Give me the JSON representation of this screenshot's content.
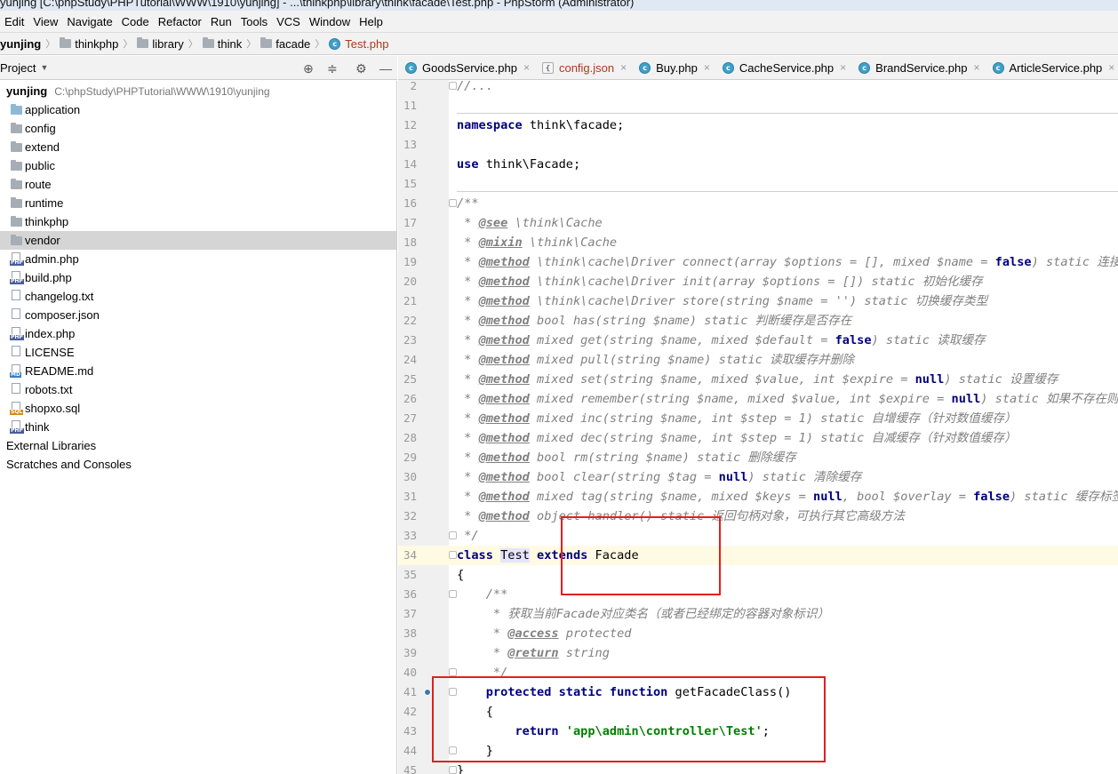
{
  "window": {
    "title": "yunjing [C:\\phpStudy\\PHPTutorial\\WWW\\1910\\yunjing] - ...\\thinkphp\\library\\think\\facade\\Test.php - PhpStorm (Administrator)"
  },
  "menu": [
    "Edit",
    "View",
    "Navigate",
    "Code",
    "Refactor",
    "Run",
    "Tools",
    "VCS",
    "Window",
    "Help"
  ],
  "breadcrumb": [
    {
      "label": "yunjing",
      "icon": "none"
    },
    {
      "label": "thinkphp",
      "icon": "folder-icon"
    },
    {
      "label": "library",
      "icon": "folder-icon"
    },
    {
      "label": "think",
      "icon": "folder-icon"
    },
    {
      "label": "facade",
      "icon": "folder-icon"
    },
    {
      "label": "Test.php",
      "icon": "php-class-icon"
    }
  ],
  "project_panel": {
    "title": "Project",
    "root": {
      "name": "yunjing",
      "path": "C:\\phpStudy\\PHPTutorial\\WWW\\1910\\yunjing"
    },
    "items": [
      {
        "name": "application",
        "icon": "folder-blue",
        "selected": false
      },
      {
        "name": "config",
        "icon": "folder",
        "selected": false
      },
      {
        "name": "extend",
        "icon": "folder",
        "selected": false
      },
      {
        "name": "public",
        "icon": "folder",
        "selected": false
      },
      {
        "name": "route",
        "icon": "folder",
        "selected": false
      },
      {
        "name": "runtime",
        "icon": "folder",
        "selected": false
      },
      {
        "name": "thinkphp",
        "icon": "folder",
        "selected": false
      },
      {
        "name": "vendor",
        "icon": "folder",
        "selected": true
      },
      {
        "name": "admin.php",
        "icon": "php",
        "selected": false
      },
      {
        "name": "build.php",
        "icon": "php",
        "selected": false
      },
      {
        "name": "changelog.txt",
        "icon": "text",
        "selected": false
      },
      {
        "name": "composer.json",
        "icon": "json",
        "selected": false
      },
      {
        "name": "index.php",
        "icon": "php",
        "selected": false
      },
      {
        "name": "LICENSE",
        "icon": "text",
        "selected": false
      },
      {
        "name": "README.md",
        "icon": "md",
        "selected": false
      },
      {
        "name": "robots.txt",
        "icon": "text",
        "selected": false
      },
      {
        "name": "shopxo.sql",
        "icon": "sql",
        "selected": false
      },
      {
        "name": "think",
        "icon": "php",
        "selected": false
      }
    ],
    "external": "External Libraries",
    "scratches": "Scratches and Consoles"
  },
  "tabs": [
    {
      "label": "GoodsService.php",
      "modified": false
    },
    {
      "label": "config.json",
      "modified": true
    },
    {
      "label": "Buy.php",
      "modified": false
    },
    {
      "label": "CacheService.php",
      "modified": false
    },
    {
      "label": "BrandService.php",
      "modified": false
    },
    {
      "label": "ArticleService.php",
      "modified": false
    }
  ],
  "editor": {
    "lines": [
      {
        "n": "2",
        "segs": [
          [
            "cm",
            "//..."
          ]
        ]
      },
      {
        "n": "11",
        "segs": []
      },
      {
        "n": "12",
        "segs": [
          [
            "kw",
            "namespace"
          ],
          [
            "",
            " think\\facade;"
          ]
        ]
      },
      {
        "n": "13",
        "segs": []
      },
      {
        "n": "14",
        "segs": [
          [
            "kw",
            "use"
          ],
          [
            "",
            " think\\Facade;"
          ]
        ]
      },
      {
        "n": "15",
        "segs": []
      },
      {
        "n": "16",
        "segs": [
          [
            "cm",
            "/**"
          ]
        ]
      },
      {
        "n": "17",
        "segs": [
          [
            "cm",
            " * "
          ],
          [
            "tg",
            "@see"
          ],
          [
            "cm",
            " \\think\\Cache"
          ]
        ]
      },
      {
        "n": "18",
        "segs": [
          [
            "cm",
            " * "
          ],
          [
            "tg",
            "@mixin"
          ],
          [
            "cm",
            " \\think\\Cache"
          ]
        ]
      },
      {
        "n": "19",
        "segs": [
          [
            "cm",
            " * "
          ],
          [
            "tg",
            "@method"
          ],
          [
            "cm",
            " \\think\\cache\\Driver connect(array $options = [], mixed $name = "
          ],
          [
            "kw",
            "false"
          ],
          [
            "cm",
            ") static 连接缓存"
          ]
        ]
      },
      {
        "n": "20",
        "segs": [
          [
            "cm",
            " * "
          ],
          [
            "tg",
            "@method"
          ],
          [
            "cm",
            " \\think\\cache\\Driver init(array $options = []) static 初始化缓存"
          ]
        ]
      },
      {
        "n": "21",
        "segs": [
          [
            "cm",
            " * "
          ],
          [
            "tg",
            "@method"
          ],
          [
            "cm",
            " \\think\\cache\\Driver store(string $name = '') static 切换缓存类型"
          ]
        ]
      },
      {
        "n": "22",
        "segs": [
          [
            "cm",
            " * "
          ],
          [
            "tg",
            "@method"
          ],
          [
            "cm",
            " bool has(string $name) static 判断缓存是否存在"
          ]
        ]
      },
      {
        "n": "23",
        "segs": [
          [
            "cm",
            " * "
          ],
          [
            "tg",
            "@method"
          ],
          [
            "cm",
            " mixed get(string $name, mixed $default = "
          ],
          [
            "kw",
            "false"
          ],
          [
            "cm",
            ") static 读取缓存"
          ]
        ]
      },
      {
        "n": "24",
        "segs": [
          [
            "cm",
            " * "
          ],
          [
            "tg",
            "@method"
          ],
          [
            "cm",
            " mixed pull(string $name) static 读取缓存并删除"
          ]
        ]
      },
      {
        "n": "25",
        "segs": [
          [
            "cm",
            " * "
          ],
          [
            "tg",
            "@method"
          ],
          [
            "cm",
            " mixed set(string $name, mixed $value, int $expire = "
          ],
          [
            "kw",
            "null"
          ],
          [
            "cm",
            ") static 设置缓存"
          ]
        ]
      },
      {
        "n": "26",
        "segs": [
          [
            "cm",
            " * "
          ],
          [
            "tg",
            "@method"
          ],
          [
            "cm",
            " mixed remember(string $name, mixed $value, int $expire = "
          ],
          [
            "kw",
            "null"
          ],
          [
            "cm",
            ") static 如果不存在则写入缓存"
          ]
        ]
      },
      {
        "n": "27",
        "segs": [
          [
            "cm",
            " * "
          ],
          [
            "tg",
            "@method"
          ],
          [
            "cm",
            " mixed inc(string $name, int $step = 1) static 自增缓存（针对数值缓存）"
          ]
        ]
      },
      {
        "n": "28",
        "segs": [
          [
            "cm",
            " * "
          ],
          [
            "tg",
            "@method"
          ],
          [
            "cm",
            " mixed dec(string $name, int $step = 1) static 自减缓存（针对数值缓存）"
          ]
        ]
      },
      {
        "n": "29",
        "segs": [
          [
            "cm",
            " * "
          ],
          [
            "tg",
            "@method"
          ],
          [
            "cm",
            " bool rm(string $name) static 删除缓存"
          ]
        ]
      },
      {
        "n": "30",
        "segs": [
          [
            "cm",
            " * "
          ],
          [
            "tg",
            "@method"
          ],
          [
            "cm",
            " bool clear(string $tag = "
          ],
          [
            "kw",
            "null"
          ],
          [
            "cm",
            ") static 清除缓存"
          ]
        ]
      },
      {
        "n": "31",
        "segs": [
          [
            "cm",
            " * "
          ],
          [
            "tg",
            "@method"
          ],
          [
            "cm",
            " mixed tag(string $name, mixed $keys = "
          ],
          [
            "kw",
            "null"
          ],
          [
            "cm",
            ", bool $overlay = "
          ],
          [
            "kw",
            "false"
          ],
          [
            "cm",
            ") static 缓存标签"
          ]
        ]
      },
      {
        "n": "32",
        "segs": [
          [
            "cm",
            " * "
          ],
          [
            "tg",
            "@method"
          ],
          [
            "cm",
            " object handler() static 返回句柄对象，可执行其它高级方法"
          ]
        ]
      },
      {
        "n": "33",
        "segs": [
          [
            "cm",
            " */"
          ]
        ]
      },
      {
        "n": "34",
        "segs": [
          [
            "kw",
            "class"
          ],
          [
            "",
            " "
          ],
          [
            "hl",
            "Test"
          ],
          [
            "",
            " "
          ],
          [
            "kw",
            "extends"
          ],
          [
            "",
            " Facade"
          ]
        ]
      },
      {
        "n": "35",
        "segs": [
          [
            "",
            "{"
          ]
        ]
      },
      {
        "n": "36",
        "segs": [
          [
            "cm",
            "    /**"
          ]
        ]
      },
      {
        "n": "37",
        "segs": [
          [
            "cm",
            "     * 获取当前Facade对应类名（或者已经绑定的容器对象标识）"
          ]
        ]
      },
      {
        "n": "38",
        "segs": [
          [
            "cm",
            "     * "
          ],
          [
            "tg",
            "@access"
          ],
          [
            "cm",
            " protected"
          ]
        ]
      },
      {
        "n": "39",
        "segs": [
          [
            "cm",
            "     * "
          ],
          [
            "tg",
            "@return"
          ],
          [
            "cm",
            " string"
          ]
        ]
      },
      {
        "n": "40",
        "segs": [
          [
            "cm",
            "     */"
          ]
        ]
      },
      {
        "n": "41",
        "segs": [
          [
            "",
            "    "
          ],
          [
            "kw",
            "protected static function"
          ],
          [
            "",
            " getFacadeClass()"
          ]
        ]
      },
      {
        "n": "42",
        "segs": [
          [
            "",
            "    {"
          ]
        ]
      },
      {
        "n": "43",
        "segs": [
          [
            "",
            "        "
          ],
          [
            "kw",
            "return"
          ],
          [
            "",
            " "
          ],
          [
            "str",
            "'app\\admin\\controller\\Test'"
          ],
          [
            "",
            ";"
          ]
        ]
      },
      {
        "n": "44",
        "segs": [
          [
            "",
            "    }"
          ]
        ]
      },
      {
        "n": "45",
        "segs": [
          [
            "",
            "}"
          ]
        ]
      }
    ]
  },
  "colors": {
    "annotation_box": "#e0201d",
    "current_line": "#fffae3",
    "keyword": "#000080",
    "comment": "#808080",
    "string": "#008000"
  }
}
